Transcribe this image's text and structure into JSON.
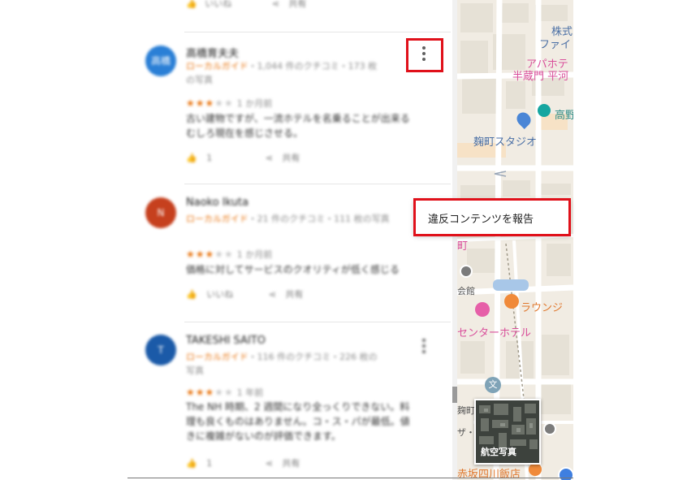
{
  "reviews": [
    {
      "avatar_letter": "高橋",
      "avatar_color": "#2a7fd6",
      "name": "高橋育夫夫",
      "guide": "ローカルガイド",
      "meta": "・1,044 件のクチコミ・173 枚",
      "meta2": "の写真",
      "stars": "★★★",
      "stars_off": "★★",
      "ago": "1 か月前",
      "text": [
        "古い建物ですが、一流ホテルを名乗ることが出来る",
        "むしろ現在を感じさせる。"
      ],
      "like": "1",
      "share": "共有"
    },
    {
      "avatar_letter": "N",
      "avatar_color": "#c6401e",
      "name": "Naoko Ikuta",
      "guide": "ローカルガイド",
      "meta": "・21 件のクチコミ・111 枚の写真",
      "meta2": "",
      "stars": "★★★",
      "stars_off": "★★",
      "ago": "1 か月前",
      "text": [
        "価格に対してサービスのクオリティが低く感じる"
      ],
      "like": "いいね",
      "share": "共有"
    },
    {
      "avatar_letter": "T",
      "avatar_color": "#1b5aa8",
      "name": "TAKESHI SAITO",
      "guide": "ローカルガイド",
      "meta": "・116 件のクチコミ・226 枚の",
      "meta2": "写真",
      "stars": "★★★",
      "stars_off": "★★",
      "ago": "1 年前",
      "text": [
        "The NH 時期、2 週間になり全っくりできない。料",
        "理も良くものはありません。コ・ス・パが最低。値",
        "きに複雑がないのが評価できます。"
      ],
      "like": "1",
      "share": "共有"
    }
  ],
  "top_actions": {
    "like": "いいね",
    "share": "共有"
  },
  "menu": {
    "report_label": "違反コンテンツを報告"
  },
  "map": {
    "labels": {
      "kabushiki": "株式",
      "fai": "ファイ",
      "apa1": "アパホテ",
      "apa2": "半蔵門 平河",
      "takano": "高野",
      "kojimachi": "麹町スタジオ",
      "kaikan": "会館",
      "lounge": "ラウンジ",
      "center": "センターホテル",
      "kojimachi2": "麹町",
      "za": "ザ・",
      "akasaka": "赤坂四川飯店",
      "kanji_cho": "町",
      "bun": "文"
    },
    "aerial_label": "航空写真"
  },
  "colors": {
    "accent_guide": "#e8710a",
    "highlight_red": "#e0101a",
    "map_pink": "#d94f9b",
    "map_blue": "#4a6fa5"
  }
}
